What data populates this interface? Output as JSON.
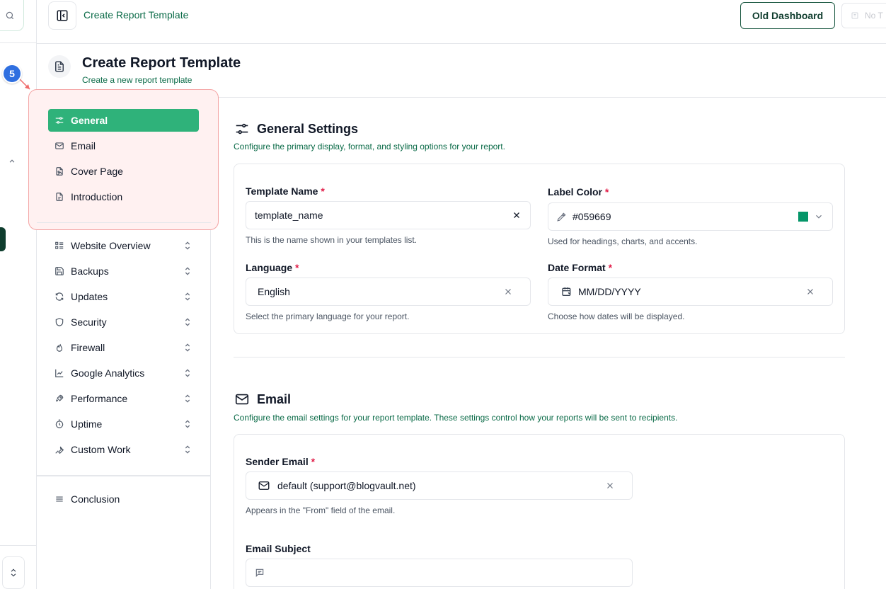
{
  "header": {
    "breadcrumb": "Create Report Template",
    "old_dashboard_label": "Old Dashboard",
    "notification_label": "No T"
  },
  "page": {
    "title": "Create Report Template",
    "subtitle": "Create a new report template"
  },
  "step_badge": "5",
  "nav": {
    "primary": [
      {
        "label": "General",
        "icon": "sliders-icon",
        "active": true
      },
      {
        "label": "Email",
        "icon": "mail-icon"
      },
      {
        "label": "Cover Page",
        "icon": "file-image-icon"
      },
      {
        "label": "Introduction",
        "icon": "file-text-icon"
      }
    ],
    "sections": [
      {
        "label": "Website Overview",
        "icon": "layout-list-icon"
      },
      {
        "label": "Backups",
        "icon": "save-icon"
      },
      {
        "label": "Updates",
        "icon": "refresh-icon"
      },
      {
        "label": "Security",
        "icon": "shield-icon"
      },
      {
        "label": "Firewall",
        "icon": "flame-icon"
      },
      {
        "label": "Google Analytics",
        "icon": "chart-line-icon"
      },
      {
        "label": "Performance",
        "icon": "rocket-icon"
      },
      {
        "label": "Uptime",
        "icon": "timer-icon"
      },
      {
        "label": "Custom Work",
        "icon": "wrench-icon"
      }
    ],
    "footer": [
      {
        "label": "Conclusion",
        "icon": "menu-icon"
      }
    ]
  },
  "general": {
    "title": "General Settings",
    "subtitle": "Configure the primary display, format, and styling options for your report.",
    "template_name": {
      "label": "Template Name",
      "value": "template_name",
      "help": "This is the name shown in your templates list."
    },
    "label_color": {
      "label": "Label Color",
      "value": "#059669",
      "swatch": "#059669",
      "help": "Used for headings, charts, and accents."
    },
    "language": {
      "label": "Language",
      "value": "English",
      "help": "Select the primary language for your report."
    },
    "date_format": {
      "label": "Date Format",
      "value": "MM/DD/YYYY",
      "help": "Choose how dates will be displayed."
    }
  },
  "email": {
    "title": "Email",
    "subtitle": "Configure the email settings for your report template. These settings control how your reports will be sent to recipients.",
    "sender": {
      "label": "Sender Email",
      "value": "default (support@blogvault.net)",
      "help": "Appears in the \"From\" field of the email."
    },
    "subject": {
      "label": "Email Subject",
      "value": ""
    }
  },
  "colors": {
    "accent": "#2fb27a",
    "brand_text": "#0b6b48",
    "highlight_border": "#f4a4a4",
    "highlight_bg": "#fff1f1",
    "step_badge": "#2f6fe0"
  }
}
